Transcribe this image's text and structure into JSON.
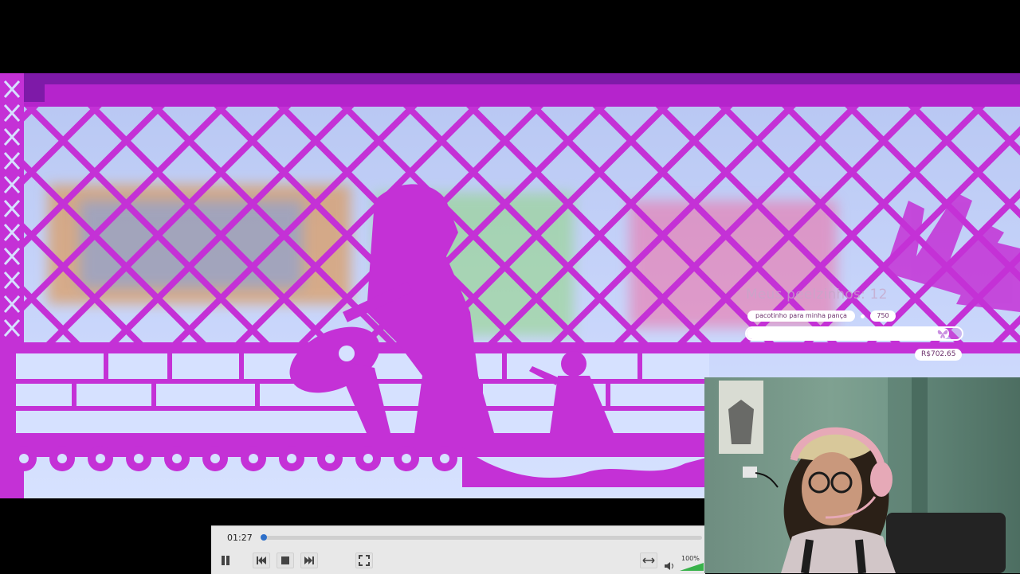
{
  "goal": {
    "heading": "Meus peelzinhos: 12",
    "label": "pacotinho para minha pança",
    "target": "750",
    "amount": "R$702.65",
    "progress_fraction": 0.94,
    "bar_color": "#ffffff"
  },
  "player": {
    "current_time": "01:27",
    "progress_fraction": 0.0,
    "volume": "100%",
    "accent_color": "#2d6fc9",
    "controls": [
      {
        "name": "pause-button",
        "icon": "pause-icon"
      },
      {
        "name": "previous-button",
        "icon": "skip-back-icon"
      },
      {
        "name": "stop-button",
        "icon": "stop-icon"
      },
      {
        "name": "next-button",
        "icon": "skip-forward-icon"
      },
      {
        "name": "fullscreen-button",
        "icon": "fullscreen-icon"
      },
      {
        "name": "aspect-button",
        "icon": "resize-horizontal-icon"
      }
    ]
  },
  "video": {
    "accent_color": "#c431d6"
  }
}
